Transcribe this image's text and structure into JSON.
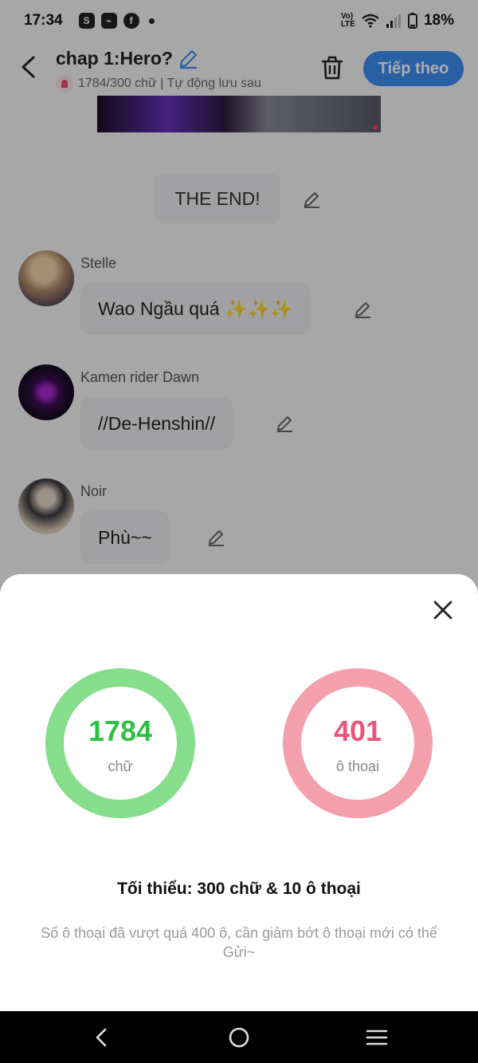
{
  "status_bar": {
    "time": "17:34",
    "volte": "VoLTE",
    "battery": "18%",
    "icons": [
      "shopee-icon",
      "messenger-icon",
      "facebook-icon",
      "dot-icon",
      "volte-icon",
      "wifi-icon",
      "signal-icon",
      "battery-icon"
    ]
  },
  "header": {
    "title": "chap 1:Hero?",
    "meta": "1784/300 chữ | Tự động lưu sau",
    "next_button": "Tiếp theo"
  },
  "story": {
    "end_text": "THE END!",
    "messages": [
      {
        "name": "Stelle",
        "text": "Wao Ngầu quá ✨✨✨"
      },
      {
        "name": "Kamen rider Dawn",
        "text": "//De-Henshin//"
      },
      {
        "name": "Noir",
        "text": "Phù~~"
      }
    ]
  },
  "sheet": {
    "words_value": "1784",
    "words_label": "chữ",
    "dialog_value": "401",
    "dialog_label": "ô thoại",
    "minimum": "Tối thiểu: 300 chữ & 10 ô thoại",
    "warning": "Số ô thoại đã vượt quá 400 ô, cần giảm bớt ô thoại mới có thể Gửi~"
  },
  "colors": {
    "accent_blue": "#3d8cf0",
    "green": "#2fbf45",
    "pink": "#e8557a"
  }
}
